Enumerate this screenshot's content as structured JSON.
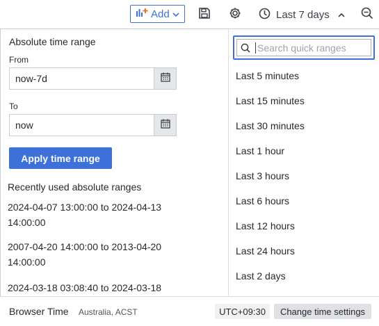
{
  "toolbar": {
    "add_label": "Add",
    "time_range_label": "Last 7 days",
    "icons": [
      "add-panel-icon",
      "chevron-down-icon",
      "save-icon",
      "gear-icon",
      "clock-icon",
      "chevron-up-icon",
      "zoom-out-icon"
    ],
    "accent": "#3d71d9"
  },
  "absolute": {
    "title": "Absolute time range",
    "from_label": "From",
    "from_value": "now-7d",
    "to_label": "To",
    "to_value": "now",
    "apply_label": "Apply time range"
  },
  "recent": {
    "title": "Recently used absolute ranges",
    "items": [
      {
        "from": "2024-04-07 13:00:00",
        "sep": "to",
        "to": "2024-04-13 14:00:00"
      },
      {
        "from": "2007-04-20 14:00:00",
        "sep": "to",
        "to": "2013-04-20 14:00:00"
      },
      {
        "from": "2024-03-18 03:08:40",
        "sep": "to",
        "to": "2024-03-18"
      }
    ]
  },
  "quick": {
    "search_placeholder": "Search quick ranges",
    "items": [
      "Last 5 minutes",
      "Last 15 minutes",
      "Last 30 minutes",
      "Last 1 hour",
      "Last 3 hours",
      "Last 6 hours",
      "Last 12 hours",
      "Last 24 hours",
      "Last 2 days"
    ]
  },
  "footer": {
    "tz_name": "Browser Time",
    "tz_region": "Australia, ACST",
    "tz_offset": "UTC+09:30",
    "change_label": "Change time settings"
  }
}
